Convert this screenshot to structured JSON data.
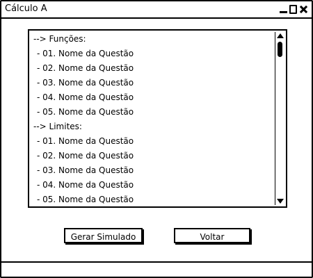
{
  "window": {
    "title": "Cálculo A"
  },
  "list": {
    "items": [
      {
        "label": "--> Funções:",
        "type": "header"
      },
      {
        "label": "- 01. Nome da Questão",
        "type": "item"
      },
      {
        "label": "- 02. Nome da Questão",
        "type": "item"
      },
      {
        "label": "- 03. Nome da Questão",
        "type": "item"
      },
      {
        "label": "- 04. Nome da Questão",
        "type": "item"
      },
      {
        "label": "- 05. Nome da Questão",
        "type": "item"
      },
      {
        "label": "--> Limites:",
        "type": "header"
      },
      {
        "label": "- 01. Nome da Questão",
        "type": "item"
      },
      {
        "label": "- 02. Nome da Questão",
        "type": "item"
      },
      {
        "label": "- 03. Nome da Questão",
        "type": "item"
      },
      {
        "label": "- 04. Nome da Questão",
        "type": "item"
      },
      {
        "label": "- 05. Nome da Questão",
        "type": "item"
      }
    ]
  },
  "buttons": {
    "generate_label": "Gerar Simulado",
    "back_label": "Voltar"
  },
  "status": {
    "text": ""
  }
}
